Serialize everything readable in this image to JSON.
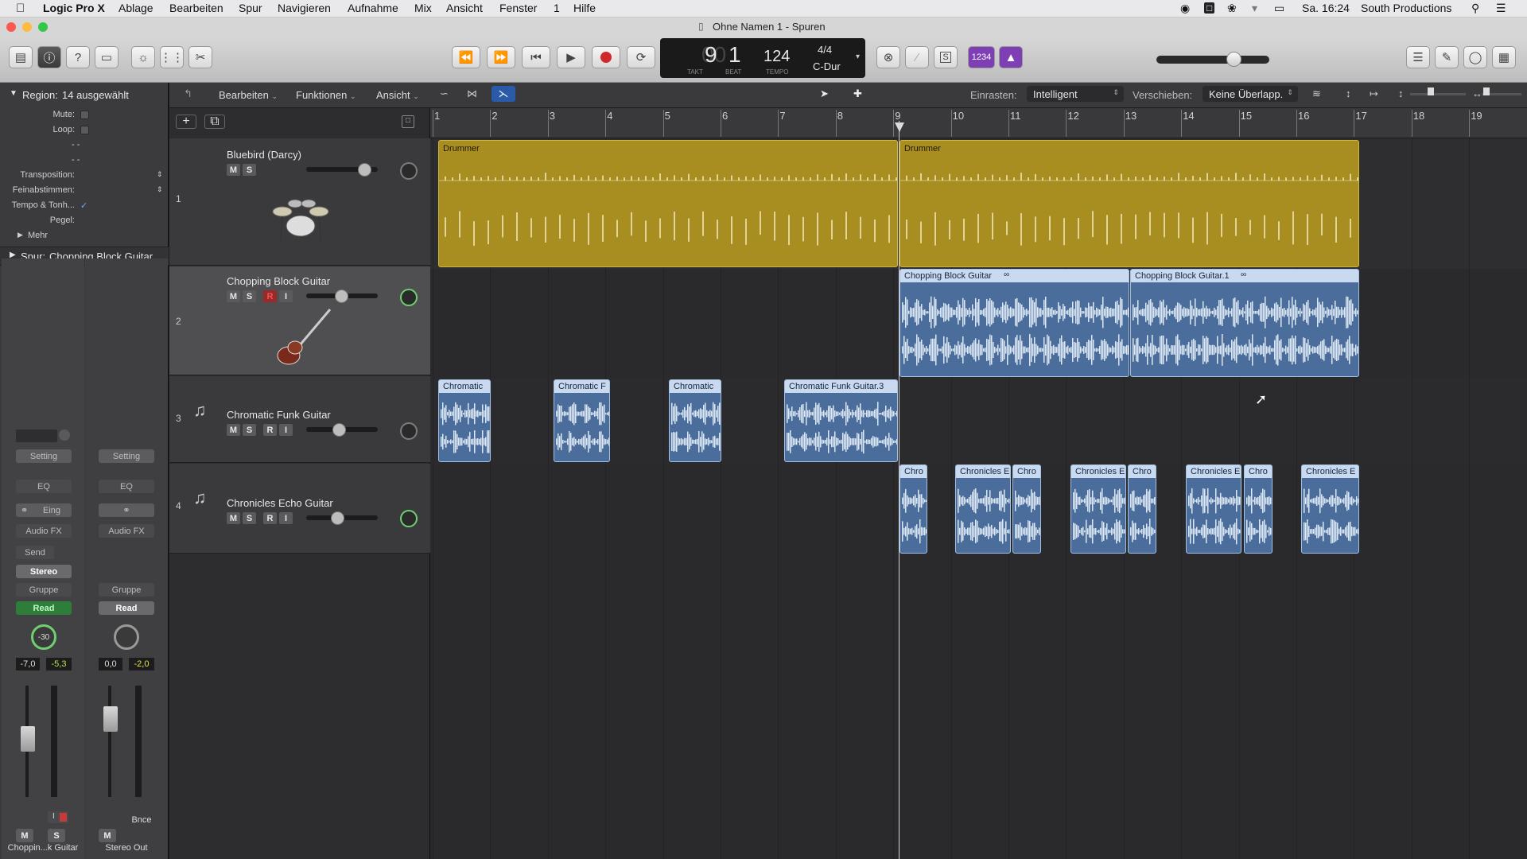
{
  "menubar": {
    "apple": "",
    "app": "Logic Pro X",
    "items": [
      "Ablage",
      "Bearbeiten",
      "Spur",
      "Navigieren",
      "Aufnahme",
      "Mix",
      "Ansicht",
      "Fenster",
      "1",
      "Hilfe"
    ],
    "clock": "Sa. 16:24",
    "user": "South Productions"
  },
  "window": {
    "title": "Ohne Namen 1 - Spuren"
  },
  "lcd": {
    "bar": "9",
    "beat": "1",
    "bar_label": "TAKT",
    "beat_label": "BEAT",
    "tempo": "124",
    "tempo_label": "TEMPO",
    "signature": "4/4",
    "key": "C-Dur"
  },
  "controlbar": {
    "count_in": "1234"
  },
  "inspector": {
    "region_label": "Region:",
    "region_value": "14 ausgewählt",
    "mute": "Mute:",
    "loop": "Loop:",
    "dash1": "- -",
    "dash2": "- -",
    "transposition": "Transposition:",
    "fine_tune": "Feinabstimmen:",
    "tempo_pitch": "Tempo & Tonh...",
    "gain": "Pegel:",
    "more": "Mehr",
    "track_label": "Spur:",
    "track_value": "Chopping Block Guitar"
  },
  "strip1": {
    "setting": "Setting",
    "eq": "EQ",
    "input": "Eing",
    "audiofx": "Audio FX",
    "send": "Send",
    "output": "Stereo",
    "group": "Gruppe",
    "automation": "Read",
    "pan": "-30",
    "vol": "-7,0",
    "peak": "-5,3",
    "m": "M",
    "s": "S",
    "name": "Choppin...k Guitar"
  },
  "strip2": {
    "setting": "Setting",
    "eq": "EQ",
    "audiofx": "Audio FX",
    "group": "Gruppe",
    "automation": "Read",
    "vol": "0,0",
    "peak": "-2,0",
    "bounce": "Bnce",
    "m": "M",
    "name": "Stereo Out"
  },
  "localbar": {
    "edit": "Bearbeiten",
    "functions": "Funktionen",
    "view": "Ansicht",
    "snap_label": "Einrasten:",
    "snap_value": "Intelligent",
    "drag_label": "Verschieben:",
    "drag_value": "Keine Überlapp."
  },
  "tracks": [
    {
      "num": "1",
      "name": "Bluebird (Darcy)",
      "m": "M",
      "s": "S"
    },
    {
      "num": "2",
      "name": "Chopping Block Guitar",
      "m": "M",
      "s": "S",
      "r": "R",
      "i": "I"
    },
    {
      "num": "3",
      "name": "Chromatic Funk Guitar",
      "m": "M",
      "s": "S",
      "r": "R",
      "i": "I"
    },
    {
      "num": "4",
      "name": "Chronicles Echo Guitar",
      "m": "M",
      "s": "S",
      "r": "R",
      "i": "I"
    }
  ],
  "ruler": [
    "1",
    "2",
    "3",
    "4",
    "5",
    "6",
    "7",
    "8",
    "9",
    "10",
    "11",
    "12",
    "13",
    "14",
    "15",
    "16",
    "17",
    "18",
    "19"
  ],
  "regions": {
    "drummer1": "Drummer",
    "drummer2": "Drummer",
    "cbg1": "Chopping Block Guitar",
    "cbg2": "Chopping Block Guitar.1",
    "cf1": "Chromatic",
    "cf2": "Chromatic F",
    "cf3": "Chromatic",
    "cf4": "Chromatic Funk Guitar.3",
    "ce": [
      "Chro",
      "Chronicles E",
      "Chro",
      "Chronicles E",
      "Chro",
      "Chronicles E",
      "Chro",
      "Chronicles E"
    ]
  },
  "colors": {
    "drummer": "#a88e20",
    "audio": "#4a6d9b",
    "automation_green": "#2f7d3a",
    "record": "#d0282a",
    "count_in": "#7e3fb5"
  }
}
